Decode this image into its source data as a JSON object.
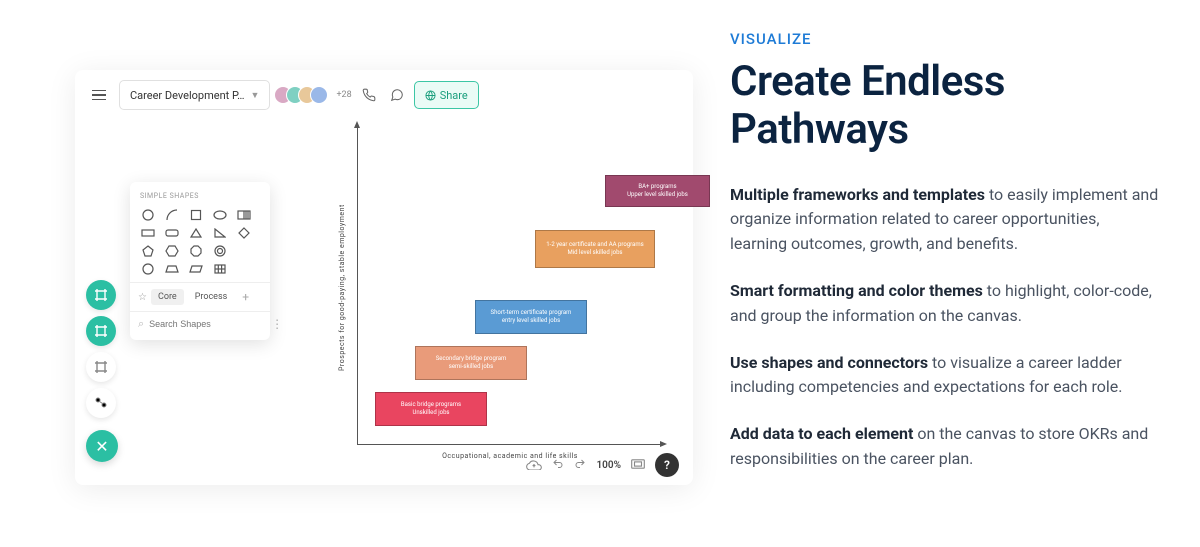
{
  "topbar": {
    "doc_name": "Career Development P…",
    "collab_count": "+28",
    "share_label": "Share"
  },
  "shapes_panel": {
    "title": "SIMPLE SHAPES",
    "tabs": {
      "core": "Core",
      "process": "Process"
    },
    "search_placeholder": "Search Shapes"
  },
  "chart_data": {
    "type": "bar",
    "title": "",
    "xlabel": "Occupational,   academic   and   life  skills",
    "ylabel": "Prospects   for   good-paying,   stable   employment",
    "steps": [
      {
        "line1": "Basic  bridge  programs",
        "line2": "Unskilled  jobs",
        "color": "#e94560"
      },
      {
        "line1": "Secondary  bridge  program",
        "line2": "semi-skilled  jobs",
        "color": "#e99b7a"
      },
      {
        "line1": "Short-term  certificate  program",
        "line2": "entry  level  skilled  jobs",
        "color": "#5a9bd4"
      },
      {
        "line1": "1-2  year  certificate   and  AA programs",
        "line2": "Mid  level  skilled  jobs",
        "color": "#e8a05f"
      },
      {
        "line1": "BA+  programs",
        "line2": "Upper  level  skilled  jobs",
        "color": "#a14a6e"
      }
    ]
  },
  "bottombar": {
    "zoom": "100%"
  },
  "marketing": {
    "eyebrow": "VISUALIZE",
    "headline": "Create Endless Pathways",
    "p1_b": "Multiple frameworks and templates",
    "p1_r": " to easily implement and organize information related to career opportunities, learning outcomes, growth, and benefits.",
    "p2_b": "Smart formatting and color themes",
    "p2_r": " to highlight, color-code, and group the information on the canvas.",
    "p3_b": "Use shapes and connectors",
    "p3_r": " to visualize a career ladder including competencies and expectations for each role.",
    "p4_b": "Add data to each element",
    "p4_r": " on the canvas to store OKRs and responsibilities on the career plan."
  }
}
